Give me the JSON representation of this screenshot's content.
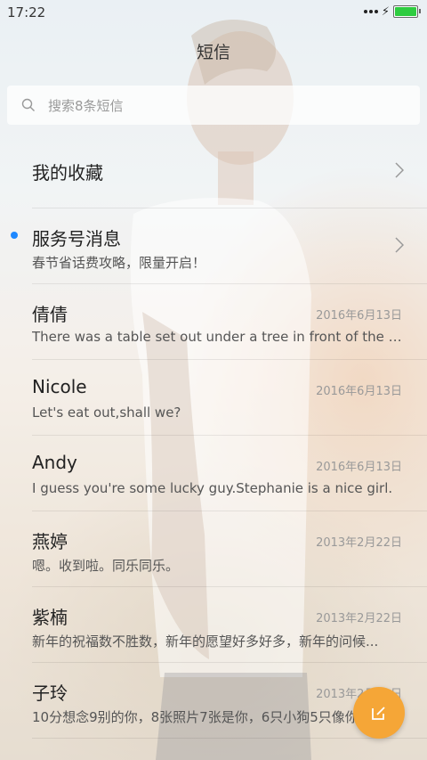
{
  "status": {
    "time": "17:22"
  },
  "header": {
    "title": "短信"
  },
  "search": {
    "placeholder": "搜索8条短信"
  },
  "conversations": [
    {
      "name": "我的收藏",
      "snippet": "",
      "date": ""
    },
    {
      "name": "服务号消息",
      "snippet": "春节省话费攻略，限量开启！",
      "date": "",
      "unread": true
    },
    {
      "name": "倩倩",
      "snippet": "There was a table set out under a tree in front of the ho...",
      "date": "2016年6月13日"
    },
    {
      "name": "Nicole",
      "snippet": "Let's eat out,shall we?",
      "date": "2016年6月13日"
    },
    {
      "name": "Andy",
      "snippet": "I guess you're some lucky guy.Stephanie is a nice girl.",
      "date": "2016年6月13日"
    },
    {
      "name": "燕婷",
      "snippet": "嗯。收到啦。同乐同乐。",
      "date": "2013年2月22日"
    },
    {
      "name": "紫楠",
      "snippet": "新年的祝福数不胜数，新年的愿望好多好多，新年的问候...",
      "date": "2013年2月22日"
    },
    {
      "name": "子玲",
      "snippet": "10分想念9别的你，8张照片7张是你，6只小狗5只像你",
      "date": "2013年2月22日"
    }
  ],
  "colors": {
    "accent": "#f5a637",
    "unread_dot": "#1e88ff"
  },
  "icons": {
    "search": "search-icon",
    "chevron": "chevron-right-icon",
    "compose": "compose-icon"
  }
}
